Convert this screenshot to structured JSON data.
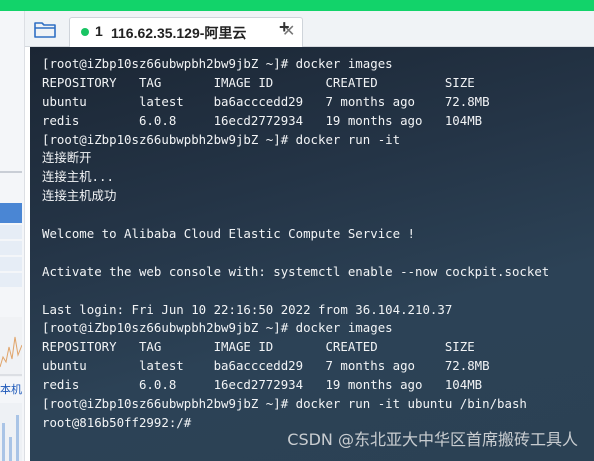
{
  "colors": {
    "accent": "#12d36a",
    "terminal_bg": "#243446",
    "tab_dot": "#19c463",
    "text": "#f2f4f6"
  },
  "left_panel": {
    "labels": [
      "本机"
    ]
  },
  "tabbar": {
    "folder_icon": "folder-icon",
    "active_tab": {
      "index": "1",
      "title": "116.62.35.129-阿里云",
      "close": "✕",
      "status": "connected"
    },
    "add_tab": "+"
  },
  "terminal": {
    "lines": [
      "[root@iZbp10sz66ubwpbh2bw9jbZ ~]# docker images",
      "REPOSITORY   TAG       IMAGE ID       CREATED         SIZE",
      "ubuntu       latest    ba6acccedd29   7 months ago    72.8MB",
      "redis        6.0.8     16ecd2772934   19 months ago   104MB",
      "[root@iZbp10sz66ubwpbh2bw9jbZ ~]# docker run -it",
      "连接断开",
      "连接主机...",
      "连接主机成功",
      "",
      "Welcome to Alibaba Cloud Elastic Compute Service !",
      "",
      "Activate the web console with: systemctl enable --now cockpit.socket",
      "",
      "Last login: Fri Jun 10 22:16:50 2022 from 36.104.210.37",
      "[root@iZbp10sz66ubwpbh2bw9jbZ ~]# docker images",
      "REPOSITORY   TAG       IMAGE ID       CREATED         SIZE",
      "ubuntu       latest    ba6acccedd29   7 months ago    72.8MB",
      "redis        6.0.8     16ecd2772934   19 months ago   104MB",
      "[root@iZbp10sz66ubwpbh2bw9jbZ ~]# docker run -it ubuntu /bin/bash",
      "root@816b50ff2992:/#"
    ]
  },
  "watermark": "CSDN @东北亚大中华区首席搬砖工具人"
}
